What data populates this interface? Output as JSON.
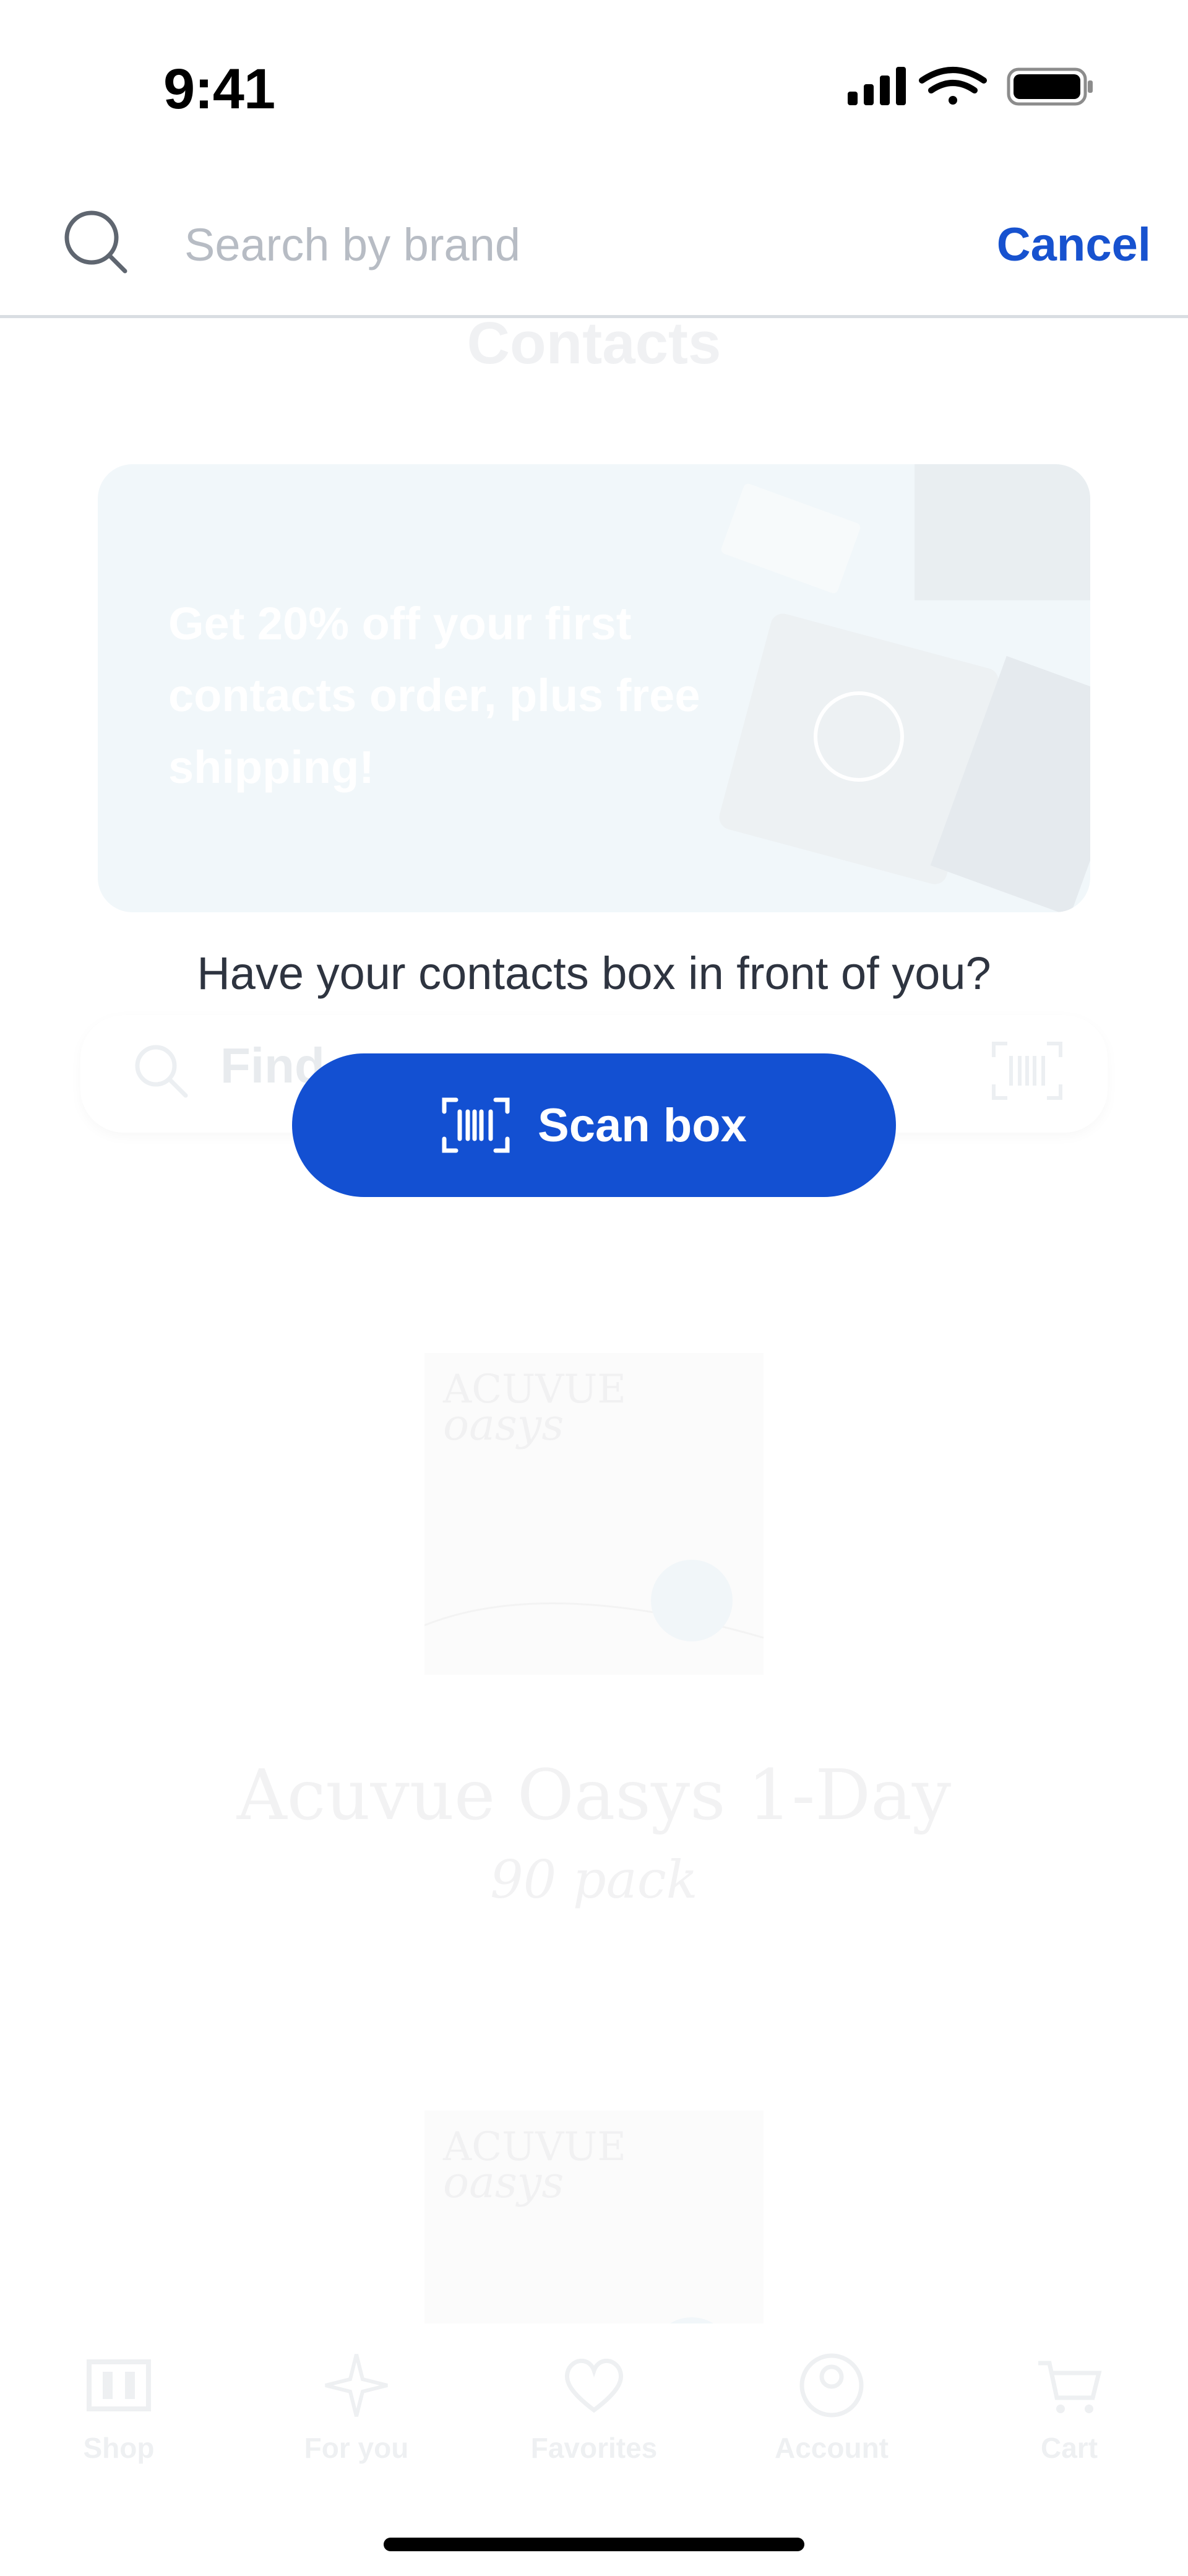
{
  "status_bar": {
    "time": "9:41",
    "icons": [
      "signal-icon",
      "wifi-icon",
      "battery-icon"
    ]
  },
  "search": {
    "placeholder": "Search by brand",
    "value": "",
    "cancel_label": "Cancel"
  },
  "background": {
    "page_title": "Contacts",
    "promo_text": "Get 20% off your first contacts order, plus free shipping!",
    "find_placeholder": "Find",
    "product": {
      "title": "Acuvue Oasys 1-Day",
      "variant": "90 pack"
    }
  },
  "scan": {
    "prompt": "Have your contacts box in front of you?",
    "button_label": "Scan box"
  },
  "tab_bar": {
    "items": [
      {
        "label": "Shop",
        "icon": "shop-icon"
      },
      {
        "label": "For you",
        "icon": "sparkle-icon"
      },
      {
        "label": "Favorites",
        "icon": "heart-icon"
      },
      {
        "label": "Account",
        "icon": "account-icon"
      },
      {
        "label": "Cart",
        "icon": "cart-icon"
      }
    ]
  },
  "colors": {
    "accent": "#1350d2",
    "cancel_text": "#1752cf",
    "placeholder": "#b7bcc4"
  }
}
